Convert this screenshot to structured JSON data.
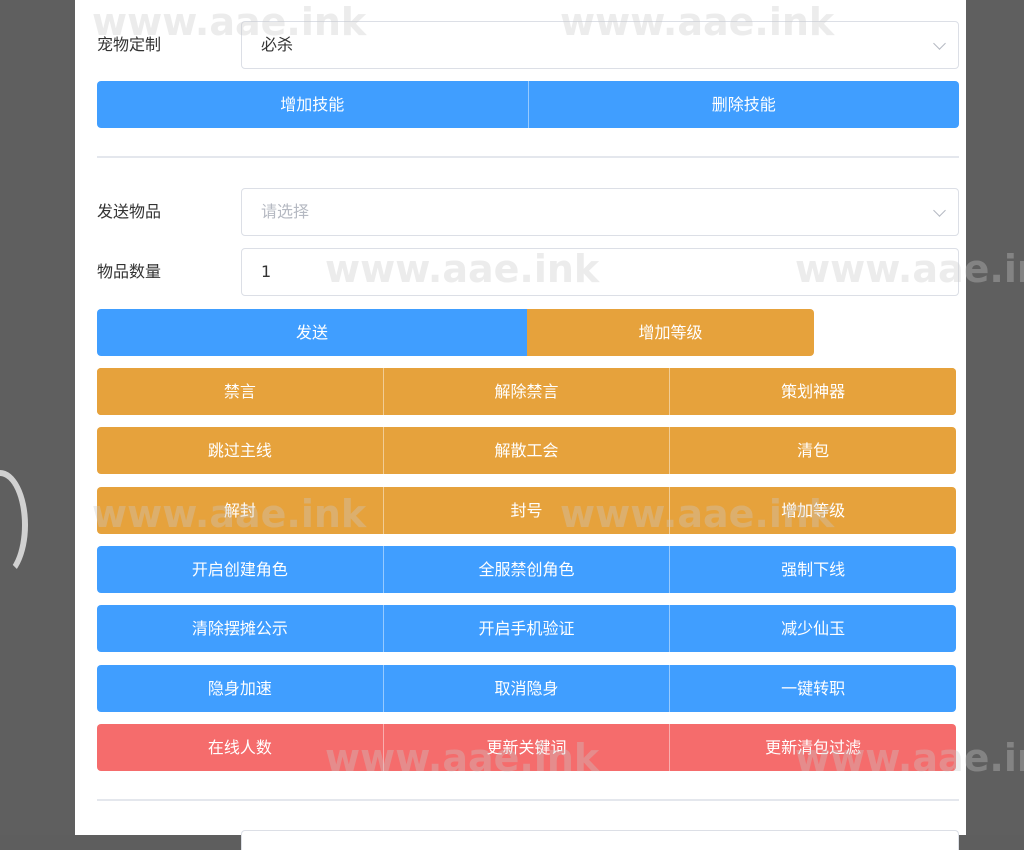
{
  "pet": {
    "label": "宠物定制",
    "value": "必杀",
    "add_skill": "增加技能",
    "delete_skill": "删除技能"
  },
  "send_item": {
    "label": "发送物品",
    "placeholder": "请选择"
  },
  "item_qty": {
    "label": "物品数量",
    "value": "1"
  },
  "send_row": {
    "send": "发送",
    "add_level": "增加等级"
  },
  "grid": [
    [
      "禁言",
      "解除禁言",
      "策划神器"
    ],
    [
      "跳过主线",
      "解散工会",
      "清包"
    ],
    [
      "解封",
      "封号",
      "增加等级"
    ],
    [
      "开启创建角色",
      "全服禁创角色",
      "强制下线"
    ],
    [
      "清除摆摊公示",
      "开启手机验证",
      "减少仙玉"
    ],
    [
      "隐身加速",
      "取消隐身",
      "一键转职"
    ],
    [
      "在线人数",
      "更新关键词",
      "更新清包过滤"
    ]
  ],
  "watermark": "www.aae.ink",
  "colors": {
    "blue": "#409eff",
    "orange": "#e6a23c",
    "red": "#f56c6c"
  }
}
